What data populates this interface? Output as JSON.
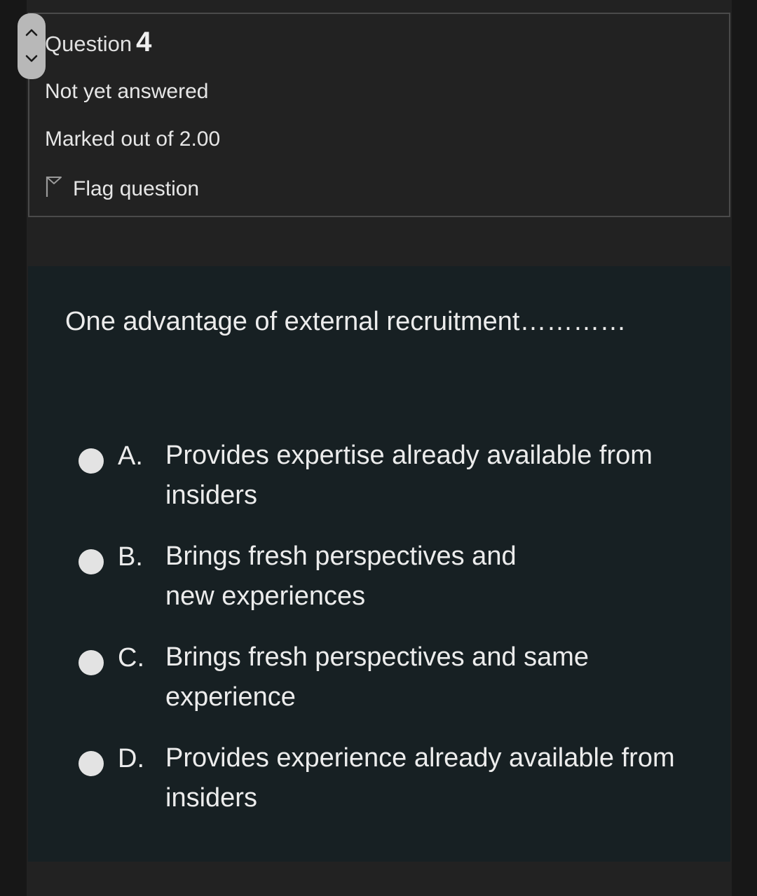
{
  "question": {
    "label": "Question",
    "number": "4",
    "state": "Not yet answered",
    "grade": "Marked out of 2.00",
    "flag_label": "Flag question",
    "text": "One advantage of external recruitment…………"
  },
  "answers": [
    {
      "letter": "A.",
      "text": "Provides expertise already available from insiders"
    },
    {
      "letter": "B.",
      "text": "Brings fresh perspectives and new experiences"
    },
    {
      "letter": "C.",
      "text": "Brings fresh perspectives and same experience"
    },
    {
      "letter": "D.",
      "text": "Provides experience already available from insiders"
    }
  ],
  "icons": {
    "flag": "flag-outline-icon",
    "scroll_up": "chevron-up-icon",
    "scroll_down": "chevron-down-icon"
  },
  "colors": {
    "page_bg": "#171717",
    "info_bg": "#222222",
    "content_bg": "#172023",
    "radio": "#e3e3e3"
  }
}
